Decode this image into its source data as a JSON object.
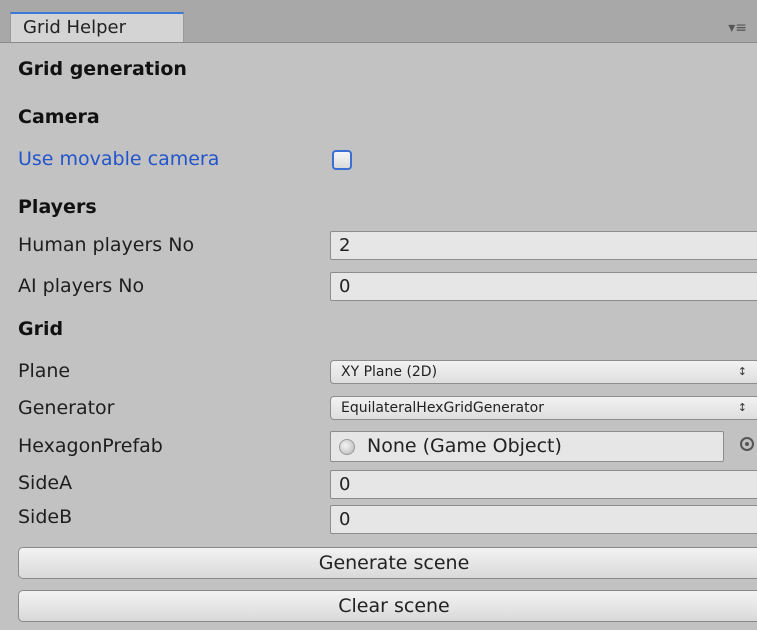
{
  "tab": {
    "title": "Grid Helper",
    "menu_icon": "▾≡"
  },
  "sections": {
    "grid_generation": "Grid generation",
    "camera": "Camera",
    "players": "Players",
    "grid": "Grid"
  },
  "camera": {
    "use_movable_label": "Use movable camera",
    "use_movable_checked": false
  },
  "players": {
    "human_label": "Human players No",
    "human_value": "2",
    "ai_label": "AI players No",
    "ai_value": "0"
  },
  "grid": {
    "plane_label": "Plane",
    "plane_value": "XY Plane (2D)",
    "generator_label": "Generator",
    "generator_value": "EquilateralHexGridGenerator",
    "prefab_label": "HexagonPrefab",
    "prefab_value": "None (Game Object)",
    "sidea_label": "SideA",
    "sidea_value": "0",
    "sideb_label": "SideB",
    "sideb_value": "0"
  },
  "buttons": {
    "generate": "Generate scene",
    "clear": "Clear scene"
  },
  "colors": {
    "accent": "#3b6fd4",
    "label_blue": "#2255cc",
    "panel": "#c2c2c2"
  }
}
